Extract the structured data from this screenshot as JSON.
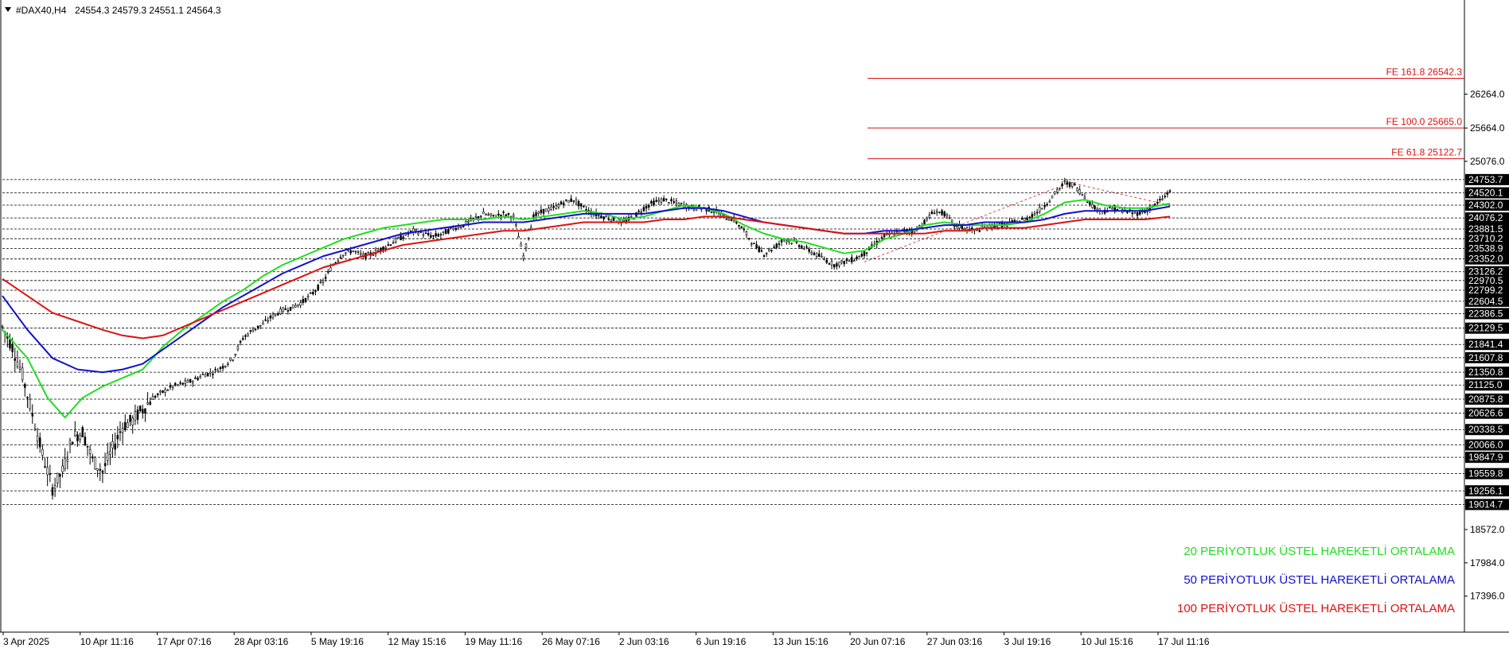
{
  "header": {
    "symbol": "#DAX40,H4",
    "ohlc": "24554.3 24579.3 24551.1 24564.3",
    "menu_icon": "triangle-down-icon"
  },
  "colors": {
    "ema20": "#22dd22",
    "ema50": "#1111cc",
    "ema100": "#dd1111",
    "fibo": "#dd1111",
    "candle": "#000000",
    "level": "#000000"
  },
  "chart_data": {
    "type": "candlestick",
    "timeframe": "H4",
    "ylim": [
      16760,
      27870
    ],
    "price_axis_ticks": [
      "26264.0",
      "25664.0",
      "25076.0",
      "18572.0",
      "17984.0",
      "17396.0"
    ],
    "level_labels": [
      "24753.7",
      "24520.1",
      "24302.0",
      "24076.2",
      "23881.5",
      "23710.2",
      "23538.9",
      "23352.0",
      "23126.2",
      "22970.5",
      "22799.2",
      "22604.5",
      "22386.5",
      "22129.5",
      "21841.4",
      "21607.8",
      "21350.8",
      "21125.0",
      "20875.8",
      "20626.6",
      "20338.5",
      "20066.0",
      "19847.9",
      "19559.8",
      "19256.1",
      "19014.7"
    ],
    "fibo_levels": [
      {
        "label": "FE 161.8 26542.3",
        "value": 26542.3
      },
      {
        "label": "FE 100.0 25665.0",
        "value": 25665.0
      },
      {
        "label": "FE 61.8 25122.7",
        "value": 25122.7
      }
    ],
    "x_labels": [
      "3 Apr 2025",
      "10 Apr 11:16",
      "17 Apr 07:16",
      "28 Apr 03:16",
      "5 May 19:16",
      "12 May 15:16",
      "19 May 11:16",
      "26 May 07:16",
      "2 Jun 03:16",
      "6 Jun 19:16",
      "13 Jun 15:16",
      "20 Jun 07:16",
      "27 Jun 03:16",
      "3 Jul 19:16",
      "10 Jul 15:16",
      "17 Jul 11:16"
    ],
    "price_path": [
      [
        0,
        22150
      ],
      [
        4,
        21800
      ],
      [
        8,
        21300
      ],
      [
        12,
        20600
      ],
      [
        16,
        19900
      ],
      [
        20,
        19300
      ],
      [
        24,
        19600
      ],
      [
        28,
        20200
      ],
      [
        32,
        20300
      ],
      [
        36,
        19800
      ],
      [
        40,
        19600
      ],
      [
        44,
        20000
      ],
      [
        48,
        20400
      ],
      [
        52,
        20500
      ],
      [
        56,
        20700
      ],
      [
        60,
        20900
      ],
      [
        64,
        21000
      ],
      [
        68,
        21100
      ],
      [
        72,
        21150
      ],
      [
        76,
        21200
      ],
      [
        80,
        21300
      ],
      [
        84,
        21350
      ],
      [
        88,
        21450
      ],
      [
        92,
        21600
      ],
      [
        96,
        21950
      ],
      [
        100,
        22100
      ],
      [
        104,
        22200
      ],
      [
        108,
        22350
      ],
      [
        112,
        22450
      ],
      [
        116,
        22500
      ],
      [
        120,
        22600
      ],
      [
        124,
        22750
      ],
      [
        128,
        22950
      ],
      [
        132,
        23250
      ],
      [
        136,
        23450
      ],
      [
        140,
        23500
      ],
      [
        144,
        23400
      ],
      [
        148,
        23450
      ],
      [
        152,
        23550
      ],
      [
        156,
        23650
      ],
      [
        160,
        23750
      ],
      [
        164,
        23850
      ],
      [
        168,
        23800
      ],
      [
        172,
        23750
      ],
      [
        176,
        23800
      ],
      [
        180,
        23900
      ],
      [
        184,
        23950
      ],
      [
        188,
        24050
      ],
      [
        192,
        24150
      ],
      [
        196,
        24100
      ],
      [
        200,
        24150
      ],
      [
        204,
        24100
      ],
      [
        208,
        23400
      ],
      [
        212,
        24100
      ],
      [
        216,
        24200
      ],
      [
        220,
        24250
      ],
      [
        224,
        24350
      ],
      [
        228,
        24400
      ],
      [
        232,
        24250
      ],
      [
        236,
        24150
      ],
      [
        240,
        24100
      ],
      [
        244,
        24050
      ],
      [
        248,
        24000
      ],
      [
        252,
        24100
      ],
      [
        256,
        24250
      ],
      [
        260,
        24350
      ],
      [
        264,
        24400
      ],
      [
        268,
        24350
      ],
      [
        272,
        24300
      ],
      [
        276,
        24250
      ],
      [
        280,
        24250
      ],
      [
        284,
        24200
      ],
      [
        288,
        24100
      ],
      [
        292,
        24050
      ],
      [
        296,
        23850
      ],
      [
        300,
        23600
      ],
      [
        304,
        23450
      ],
      [
        308,
        23550
      ],
      [
        312,
        23700
      ],
      [
        316,
        23650
      ],
      [
        320,
        23550
      ],
      [
        324,
        23450
      ],
      [
        328,
        23350
      ],
      [
        332,
        23250
      ],
      [
        336,
        23300
      ],
      [
        340,
        23350
      ],
      [
        344,
        23450
      ],
      [
        348,
        23600
      ],
      [
        352,
        23750
      ],
      [
        356,
        23800
      ],
      [
        360,
        23850
      ],
      [
        364,
        23850
      ],
      [
        368,
        24000
      ],
      [
        372,
        24200
      ],
      [
        376,
        24150
      ],
      [
        380,
        23950
      ],
      [
        384,
        23900
      ],
      [
        388,
        23850
      ],
      [
        392,
        23900
      ],
      [
        396,
        23950
      ],
      [
        400,
        23950
      ],
      [
        404,
        24000
      ],
      [
        408,
        24050
      ],
      [
        412,
        24150
      ],
      [
        416,
        24300
      ],
      [
        420,
        24500
      ],
      [
        424,
        24700
      ],
      [
        428,
        24650
      ],
      [
        432,
        24450
      ],
      [
        436,
        24250
      ],
      [
        440,
        24200
      ],
      [
        444,
        24250
      ],
      [
        448,
        24200
      ],
      [
        452,
        24150
      ],
      [
        456,
        24200
      ],
      [
        460,
        24300
      ],
      [
        464,
        24450
      ],
      [
        466,
        24564
      ]
    ],
    "series": [
      {
        "name": "20 PERİYOTLUK ÜSTEL HAREKETLİ ORTALAMA",
        "color": "#22dd22",
        "points": [
          [
            0,
            22100
          ],
          [
            10,
            21600
          ],
          [
            18,
            20900
          ],
          [
            25,
            20550
          ],
          [
            32,
            20900
          ],
          [
            40,
            21100
          ],
          [
            48,
            21250
          ],
          [
            56,
            21400
          ],
          [
            64,
            21800
          ],
          [
            72,
            22100
          ],
          [
            80,
            22350
          ],
          [
            88,
            22600
          ],
          [
            96,
            22800
          ],
          [
            104,
            23050
          ],
          [
            112,
            23250
          ],
          [
            120,
            23400
          ],
          [
            128,
            23550
          ],
          [
            136,
            23700
          ],
          [
            144,
            23800
          ],
          [
            152,
            23900
          ],
          [
            160,
            23950
          ],
          [
            168,
            24000
          ],
          [
            176,
            24050
          ],
          [
            184,
            24050
          ],
          [
            192,
            24050
          ],
          [
            200,
            24100
          ],
          [
            208,
            24050
          ],
          [
            216,
            24100
          ],
          [
            224,
            24150
          ],
          [
            232,
            24200
          ],
          [
            240,
            24150
          ],
          [
            248,
            24050
          ],
          [
            256,
            24100
          ],
          [
            264,
            24200
          ],
          [
            272,
            24300
          ],
          [
            280,
            24250
          ],
          [
            288,
            24150
          ],
          [
            296,
            23950
          ],
          [
            304,
            23800
          ],
          [
            312,
            23700
          ],
          [
            320,
            23650
          ],
          [
            328,
            23550
          ],
          [
            336,
            23450
          ],
          [
            344,
            23500
          ],
          [
            352,
            23700
          ],
          [
            360,
            23800
          ],
          [
            368,
            23950
          ],
          [
            376,
            24000
          ],
          [
            384,
            23950
          ],
          [
            392,
            23950
          ],
          [
            400,
            23950
          ],
          [
            408,
            24000
          ],
          [
            416,
            24150
          ],
          [
            424,
            24350
          ],
          [
            432,
            24400
          ],
          [
            440,
            24300
          ],
          [
            448,
            24250
          ],
          [
            456,
            24250
          ],
          [
            466,
            24330
          ]
        ]
      },
      {
        "name": "50 PERİYOTLUK ÜSTEL HAREKETLİ ORTALAMA",
        "color": "#1111cc",
        "points": [
          [
            0,
            22700
          ],
          [
            10,
            22100
          ],
          [
            20,
            21600
          ],
          [
            30,
            21400
          ],
          [
            40,
            21350
          ],
          [
            48,
            21400
          ],
          [
            56,
            21500
          ],
          [
            64,
            21750
          ],
          [
            72,
            22000
          ],
          [
            80,
            22250
          ],
          [
            88,
            22500
          ],
          [
            96,
            22700
          ],
          [
            104,
            22900
          ],
          [
            112,
            23100
          ],
          [
            120,
            23250
          ],
          [
            128,
            23400
          ],
          [
            136,
            23500
          ],
          [
            144,
            23600
          ],
          [
            152,
            23700
          ],
          [
            160,
            23800
          ],
          [
            168,
            23850
          ],
          [
            176,
            23900
          ],
          [
            184,
            23950
          ],
          [
            192,
            24000
          ],
          [
            200,
            24000
          ],
          [
            208,
            24000
          ],
          [
            216,
            24050
          ],
          [
            224,
            24100
          ],
          [
            232,
            24150
          ],
          [
            240,
            24150
          ],
          [
            248,
            24150
          ],
          [
            256,
            24150
          ],
          [
            264,
            24200
          ],
          [
            272,
            24250
          ],
          [
            280,
            24250
          ],
          [
            288,
            24200
          ],
          [
            296,
            24100
          ],
          [
            304,
            24000
          ],
          [
            312,
            23950
          ],
          [
            320,
            23900
          ],
          [
            328,
            23850
          ],
          [
            336,
            23800
          ],
          [
            344,
            23800
          ],
          [
            352,
            23850
          ],
          [
            360,
            23850
          ],
          [
            368,
            23900
          ],
          [
            376,
            23950
          ],
          [
            384,
            23950
          ],
          [
            392,
            24000
          ],
          [
            400,
            24000
          ],
          [
            408,
            24000
          ],
          [
            416,
            24050
          ],
          [
            424,
            24150
          ],
          [
            432,
            24200
          ],
          [
            440,
            24200
          ],
          [
            448,
            24200
          ],
          [
            456,
            24200
          ],
          [
            466,
            24280
          ]
        ]
      },
      {
        "name": "100 PERİYOTLUK ÜSTEL HAREKETLİ ORTALAMA",
        "color": "#dd1111",
        "points": [
          [
            0,
            23000
          ],
          [
            10,
            22700
          ],
          [
            20,
            22400
          ],
          [
            30,
            22250
          ],
          [
            40,
            22100
          ],
          [
            48,
            22000
          ],
          [
            56,
            21950
          ],
          [
            64,
            22000
          ],
          [
            72,
            22150
          ],
          [
            80,
            22300
          ],
          [
            88,
            22450
          ],
          [
            96,
            22600
          ],
          [
            104,
            22750
          ],
          [
            112,
            22900
          ],
          [
            120,
            23050
          ],
          [
            128,
            23200
          ],
          [
            136,
            23300
          ],
          [
            144,
            23400
          ],
          [
            152,
            23500
          ],
          [
            160,
            23600
          ],
          [
            168,
            23650
          ],
          [
            176,
            23700
          ],
          [
            184,
            23750
          ],
          [
            192,
            23800
          ],
          [
            200,
            23850
          ],
          [
            208,
            23850
          ],
          [
            216,
            23900
          ],
          [
            224,
            23950
          ],
          [
            232,
            24000
          ],
          [
            240,
            24000
          ],
          [
            248,
            24000
          ],
          [
            256,
            24000
          ],
          [
            264,
            24050
          ],
          [
            272,
            24050
          ],
          [
            280,
            24100
          ],
          [
            288,
            24100
          ],
          [
            296,
            24050
          ],
          [
            304,
            24000
          ],
          [
            312,
            23950
          ],
          [
            320,
            23900
          ],
          [
            328,
            23850
          ],
          [
            336,
            23800
          ],
          [
            344,
            23800
          ],
          [
            352,
            23800
          ],
          [
            360,
            23800
          ],
          [
            368,
            23800
          ],
          [
            376,
            23850
          ],
          [
            384,
            23850
          ],
          [
            392,
            23900
          ],
          [
            400,
            23900
          ],
          [
            408,
            23900
          ],
          [
            416,
            23950
          ],
          [
            424,
            24000
          ],
          [
            432,
            24050
          ],
          [
            440,
            24050
          ],
          [
            448,
            24050
          ],
          [
            456,
            24050
          ],
          [
            466,
            24100
          ]
        ]
      }
    ],
    "trend_lines": [
      [
        [
          344,
          23300
        ],
        [
          426,
          24700
        ],
        [
          466,
          24300
        ]
      ]
    ],
    "legend_placement": "bottom-right",
    "grid": false
  }
}
